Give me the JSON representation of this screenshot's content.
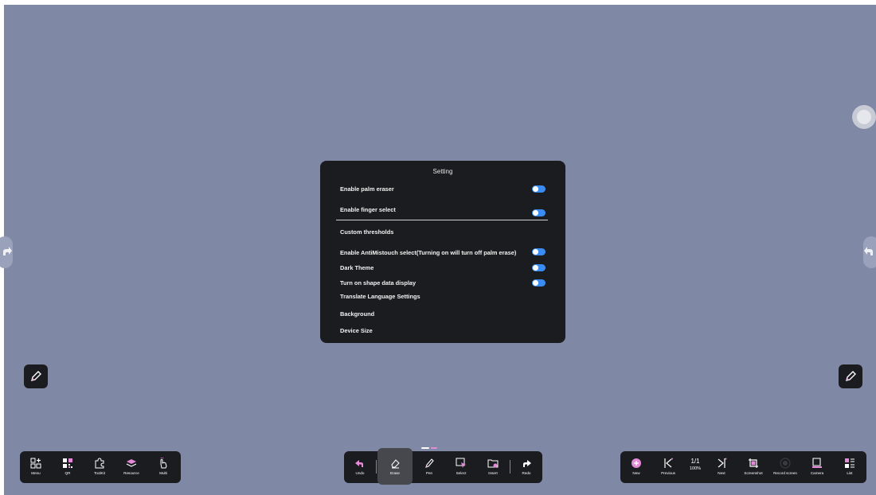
{
  "settings": {
    "title": "Setting",
    "rows": [
      {
        "label": "Enable palm eraser",
        "toggle": true
      },
      {
        "label": "Enable finger select",
        "toggle": true
      },
      {
        "label": "Custom thresholds",
        "toggle": false
      },
      {
        "label": "Enable AntiMistouch select(Turning on will turn off palm erase)",
        "toggle": true
      },
      {
        "label": "Dark Theme",
        "toggle": true
      },
      {
        "label": "Turn on shape data display",
        "toggle": true
      },
      {
        "label": "Translate Language Settings",
        "toggle": false
      },
      {
        "label": "Background",
        "toggle": false
      },
      {
        "label": "Device Size",
        "toggle": false
      }
    ]
  },
  "left_toolbar": [
    "Menu",
    "QR",
    "ToolKit",
    "Resource",
    "Multi"
  ],
  "center_toolbar": {
    "undo": "Undo",
    "erase": "Erase",
    "pen": "Pen",
    "select": "Select",
    "insert": "Insert",
    "redo": "Redo"
  },
  "right_toolbar": {
    "new": "New",
    "previous": "Previous",
    "page": "1/1",
    "zoom": "100%",
    "next": "Next",
    "screenshot": "Screenshot",
    "record": "Record screen",
    "camera": "Camera",
    "list": "List"
  },
  "colors": {
    "canvas": "#7f88a5",
    "panel": "#1b1c1f",
    "toggle_on": "#3a8cf2",
    "accent_pink": "#e58ad8"
  }
}
